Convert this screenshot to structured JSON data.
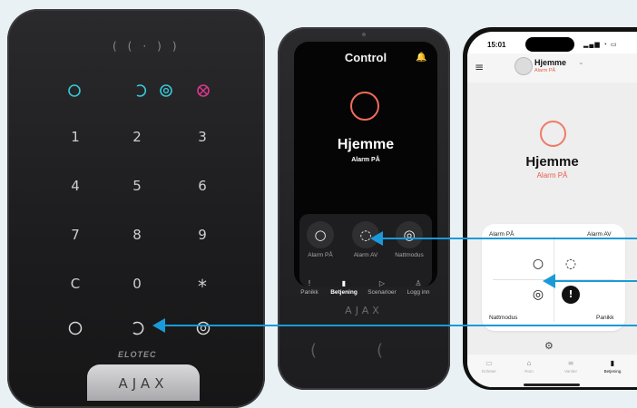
{
  "colors": {
    "accent_arrow": "#1a9ad8",
    "alarm_red": "#e85c4a",
    "keypad_teal": "#37c7d6",
    "keypad_magenta": "#d9378a"
  },
  "keypad": {
    "nfc_icon": "nfc-waves-icon",
    "status_icons": [
      "armed-ring-icon",
      "disarmed-arc-icon",
      "night-mode-icon",
      "alarm-cross-icon"
    ],
    "keys": [
      "1",
      "2",
      "3",
      "4",
      "5",
      "6",
      "7",
      "8",
      "9",
      "C",
      "0",
      "*"
    ],
    "function_icons": [
      "arm-button-icon",
      "disarm-button-icon",
      "night-button-icon"
    ],
    "brand": "ELOTEC",
    "logo": "AJAX"
  },
  "touch_panel": {
    "title": "Control",
    "bell_icon": "bell-icon",
    "status": "Hjemme",
    "status_sub": "Alarm PÅ",
    "mode_buttons": [
      {
        "label": "Alarm PÅ",
        "icon": "○"
      },
      {
        "label": "Alarm AV",
        "icon": "◌"
      },
      {
        "label": "Nattmodus",
        "icon": "◎"
      }
    ],
    "nav": [
      {
        "label": "Panikk",
        "icon": "!"
      },
      {
        "label": "Betjening",
        "icon": "▮"
      },
      {
        "label": "Scenarioer",
        "icon": "▷"
      },
      {
        "label": "Logg inn",
        "icon": "♙"
      }
    ],
    "logo": "AJAX"
  },
  "phone": {
    "time": "15:01",
    "system_icons": "signal-wifi-battery",
    "hub_name": "Hjemme",
    "hub_sub": "Alarm PÅ",
    "status": "Hjemme",
    "status_sub": "Alarm PÅ",
    "card": {
      "arm_label": "Alarm PÅ",
      "disarm_label": "Alarm AV",
      "night_label": "Nattmodus",
      "panic_label": "Panikk"
    },
    "tabs": [
      {
        "label": "Enheter",
        "icon": "▭"
      },
      {
        "label": "Rom",
        "icon": "⌂"
      },
      {
        "label": "Varsler",
        "icon": "≡"
      },
      {
        "label": "Betjening",
        "icon": "▮"
      }
    ]
  }
}
